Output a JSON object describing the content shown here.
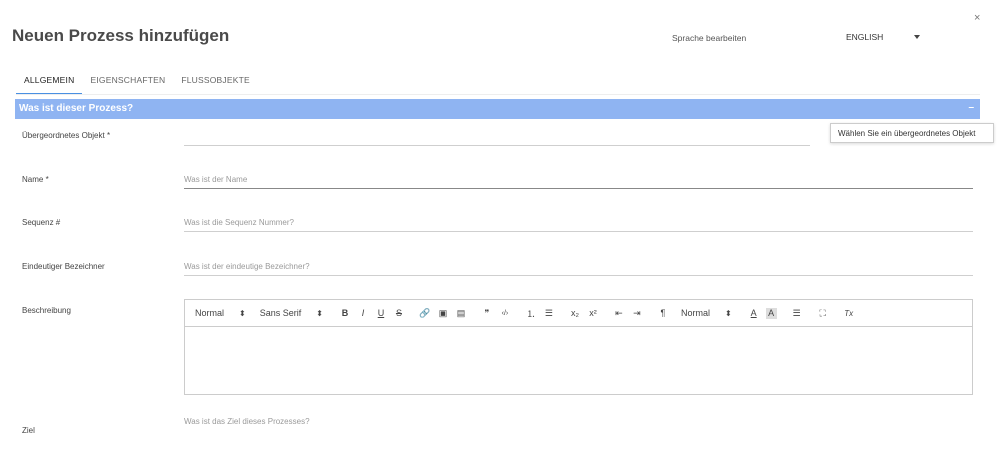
{
  "header": {
    "title": "Neuen Prozess hinzufügen",
    "language_label": "Sprache bearbeiten",
    "language_value": "ENGLISH",
    "close_symbol": "×"
  },
  "tabs": [
    {
      "label": "ALLGEMEIN",
      "active": true
    },
    {
      "label": "EIGENSCHAFTEN",
      "active": false
    },
    {
      "label": "FLUSSOBJEKTE",
      "active": false
    }
  ],
  "section": {
    "title": "Was ist dieser Prozess?",
    "collapse_symbol": "–",
    "color": "#8fb4f2"
  },
  "fields": {
    "parent": {
      "label": "Übergeordnetes Objekt  *",
      "value": "",
      "placeholder": ""
    },
    "name": {
      "label": "Name *",
      "placeholder": "Was ist der Name"
    },
    "sequence": {
      "label": "Sequenz #",
      "placeholder": "Was ist die Sequenz Nummer?"
    },
    "identifier": {
      "label": "Eindeutiger Bezeichner",
      "placeholder": "Was ist der eindeutige Bezeichner?"
    },
    "description": {
      "label": "Beschreibung"
    },
    "goal": {
      "label": "Ziel",
      "placeholder": "Was ist das Ziel dieses Prozesses?"
    }
  },
  "tooltip": "Wählen Sie ein übergeordnetes Objekt",
  "editor": {
    "heading_select": "Normal",
    "font_select": "Sans Serif",
    "size_select": "Normal",
    "select_arrow": "⬍",
    "buttons": {
      "bold": "B",
      "italic": "I",
      "underline": "U",
      "strike": "S",
      "link": "🔗",
      "image": "▣",
      "video": "▤",
      "blockquote": "❞",
      "code": "‹/›",
      "ordered_list": "⒈",
      "bullet_list": "☰",
      "subscript": "x₂",
      "superscript": "x²",
      "outdent": "⇤",
      "indent": "⇥",
      "direction": "¶",
      "text_color": "A",
      "background_color": "A",
      "align": "☰",
      "fullscreen": "⛶",
      "clean": "Tx"
    }
  }
}
